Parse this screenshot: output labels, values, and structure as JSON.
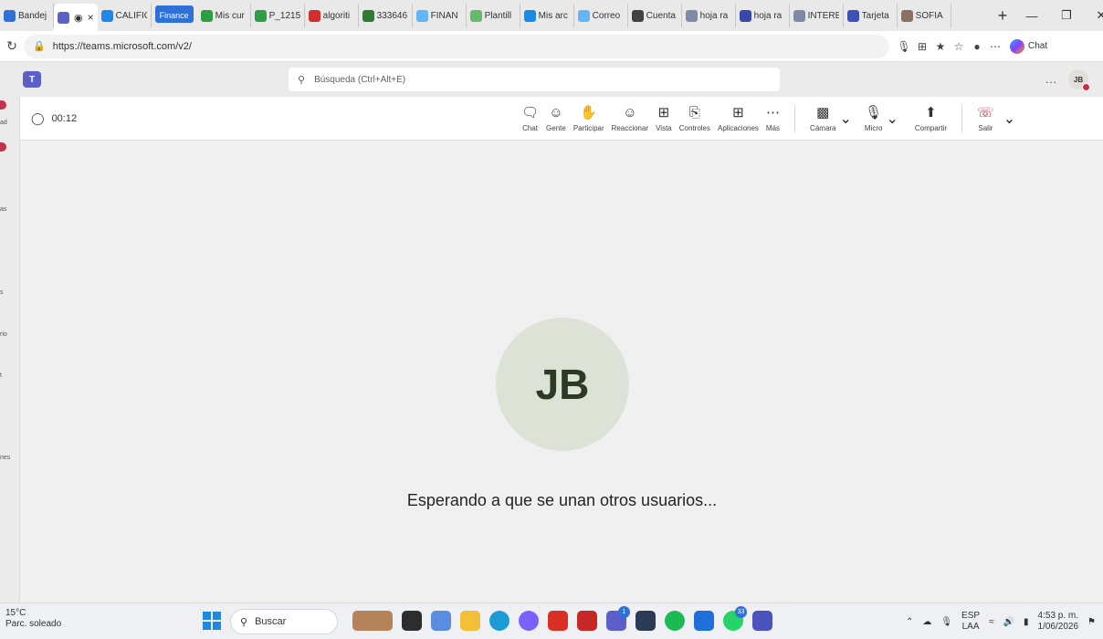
{
  "browser": {
    "tabs": [
      {
        "label": "Bandej",
        "color": "#2f6fd8"
      },
      {
        "label": "",
        "color": "#5b5fc7",
        "active": true
      },
      {
        "label": "CALIFIC",
        "color": "#1e88e5"
      },
      {
        "label": "Finance",
        "group": true
      },
      {
        "label": "Mis cur",
        "color": "#2e9e44"
      },
      {
        "label": "P_1215",
        "color": "#2e9e44"
      },
      {
        "label": "algoriti",
        "color": "#d32f2f"
      },
      {
        "label": "333646",
        "color": "#2e7d32"
      },
      {
        "label": "FINAN",
        "color": "#64b5f6"
      },
      {
        "label": "Plantill",
        "color": "#66bb6a"
      },
      {
        "label": "Mis arc",
        "color": "#1e88e5"
      },
      {
        "label": "Correo",
        "color": "#64b5f6"
      },
      {
        "label": "Cuenta",
        "color": "#424242"
      },
      {
        "label": "hoja ra",
        "color": "#7e8ba6"
      },
      {
        "label": "hoja ra",
        "color": "#3949ab"
      },
      {
        "label": "INTERE",
        "color": "#7e8ba6"
      },
      {
        "label": "Tarjeta",
        "color": "#3f51b5"
      },
      {
        "label": "SOFIA",
        "color": "#8d6e63"
      }
    ],
    "new_tab": "+",
    "url": "https://teams.microsoft.com/v2/",
    "copilot_label": "Chat"
  },
  "teams": {
    "search_placeholder": "Búsqueda (Ctrl+Alt+E)",
    "avatar_initials": "JB",
    "more": "..."
  },
  "left_rail": {
    "labels": [
      "ad",
      "as",
      "s",
      "rio",
      "t",
      "nes"
    ]
  },
  "meeting": {
    "timer": "00:12",
    "controls": [
      {
        "label": "Chat",
        "icon": "chat-icon"
      },
      {
        "label": "Gente",
        "icon": "people-icon"
      },
      {
        "label": "Participar",
        "icon": "raise-hand-icon"
      },
      {
        "label": "Reaccionar",
        "icon": "smiley-icon"
      },
      {
        "label": "Vista",
        "icon": "grid-icon"
      },
      {
        "label": "Controles",
        "icon": "controls-icon"
      },
      {
        "label": "Aplicaciones",
        "icon": "add-apps-icon"
      },
      {
        "label": "Más",
        "icon": "more-icon"
      }
    ],
    "camera_label": "Cámara",
    "mic_label": "Micro",
    "share_label": "Compartir",
    "leave_label": "Salir",
    "participant_initials": "JB",
    "waiting_text": "Esperando a que se unan otros usuarios..."
  },
  "taskbar": {
    "weather_temp": "15°C",
    "weather_desc": "Parc. soleado",
    "search_label": "Buscar",
    "badges": {
      "teams": "1",
      "whatsapp": "33"
    },
    "lang_top": "ESP",
    "lang_bottom": "LAA",
    "time": "4:53 p. m.",
    "date": "1/06/2026"
  }
}
